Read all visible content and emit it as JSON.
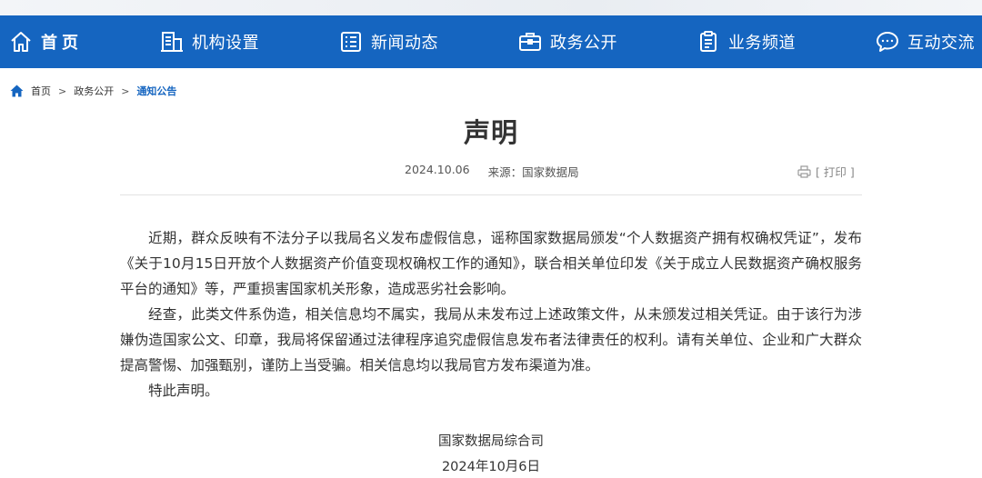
{
  "nav": {
    "items": [
      {
        "label": "首页",
        "icon": "home-icon"
      },
      {
        "label": "机构设置",
        "icon": "building-icon"
      },
      {
        "label": "新闻动态",
        "icon": "news-icon"
      },
      {
        "label": "政务公开",
        "icon": "briefcase-icon"
      },
      {
        "label": "业务频道",
        "icon": "clipboard-icon"
      },
      {
        "label": "互动交流",
        "icon": "chat-icon"
      }
    ],
    "background": "#1565c0"
  },
  "breadcrumb": {
    "home": "首页",
    "sep": ">",
    "level1": "政务公开",
    "current": "通知公告"
  },
  "article": {
    "title": "声明",
    "date": "2024.10.06",
    "source": "来源：国家数据局",
    "print_label": "[ 打印 ]",
    "paragraphs": [
      "近期，群众反映有不法分子以我局名义发布虚假信息，谣称国家数据局颁发“个人数据资产拥有权确权凭证”，发布《关于10月15日开放个人数据资产价值变现权确权工作的通知》，联合相关单位印发《关于成立人民数据资产确权服务平台的通知》等，严重损害国家机关形象，造成恶劣社会影响。",
      "经查，此类文件系伪造，相关信息均不属实，我局从未发布过上述政策文件，从未颁发过相关凭证。由于该行为涉嫌伪造国家公文、印章，我局将保留通过法律程序追究虚假信息发布者法律责任的权利。请有关单位、企业和广大群众提高警惕、加强甄别，谨防上当受骗。相关信息均以我局官方发布渠道为准。",
      "特此声明。"
    ],
    "signature_org": "国家数据局综合司",
    "signature_date": "2024年10月6日"
  }
}
